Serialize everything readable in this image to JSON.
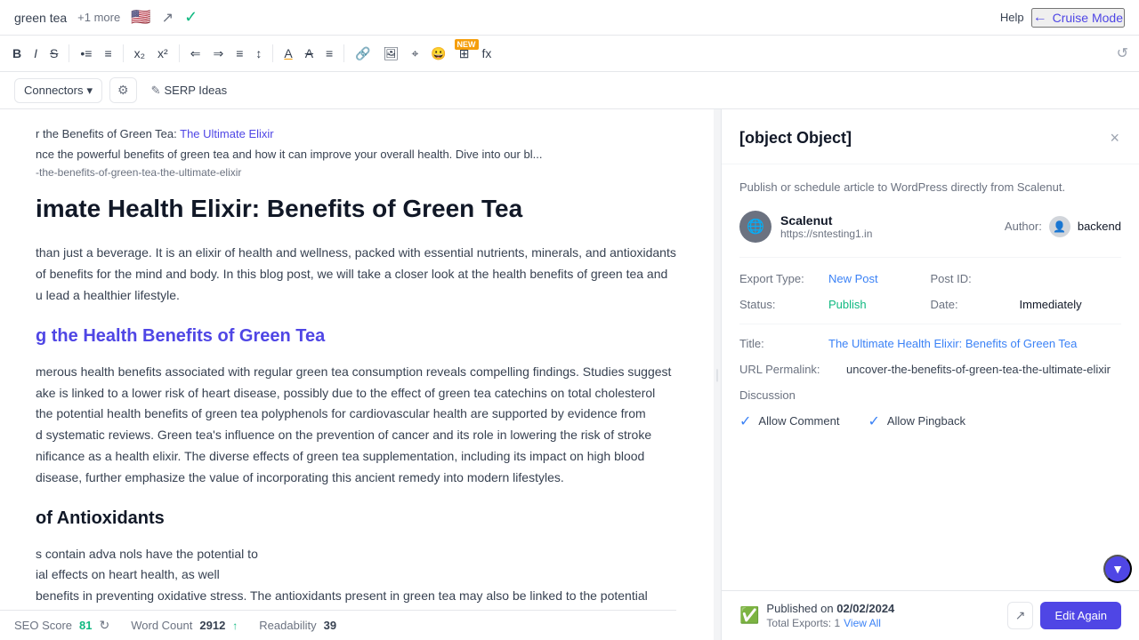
{
  "topBar": {
    "docTitle": "green tea",
    "moreCount": "+1 more",
    "helpLabel": "Help",
    "cruiseModeLabel": "Cruise Mode",
    "checkLabel": "Done"
  },
  "toolbar": {
    "buttons": [
      "B",
      "I",
      "S",
      "•≡",
      "≡",
      "x₂",
      "x²",
      "←≡",
      "→≡",
      "≡←",
      "↕",
      "A",
      "A̶",
      "≡",
      "🔗",
      "🖼",
      "⊞",
      "😊",
      "⊡",
      "fx"
    ],
    "historyIcon": "↺"
  },
  "secondaryToolbar": {
    "connectorsLabel": "Connectors",
    "settingsIcon": "⚙",
    "serpIdeasLabel": "SERP Ideas"
  },
  "article": {
    "metaLabel": "r the Benefits of Green Tea:",
    "metaLink": "The Ultimate Elixir",
    "descText": "nce the powerful benefits of green tea and how it can improve your overall health. Dive into our bl...",
    "urlSlug": "-the-benefits-of-green-tea-the-ultimate-elixir",
    "heading": "imate Health Elixir: Benefits of Green Tea",
    "body1": "than just a beverage. It is an elixir of health and wellness, packed with essential nutrients, minerals, and antioxidants",
    "body2": "of benefits for the mind and body. In this blog post, we will take a closer look at the health benefits of green tea and",
    "body3": "u lead a healthier lifestyle.",
    "section1Heading": "g the Health Benefits of Green Tea",
    "bodySection2a": "merous health benefits associated with regular green tea consumption reveals compelling findings. Studies suggest",
    "bodySection2b": "ake is linked to a lower risk of heart disease, possibly due to the effect of green tea catechins on total cholesterol",
    "bodySection2c": "the potential health benefits of green tea polyphenols for cardiovascular health are supported by evidence from",
    "bodySection2d": "d systematic reviews. Green tea's influence on the prevention of cancer and its role in lowering the risk of stroke",
    "bodySection2e": "nificance as a health elixir. The diverse effects of green tea supplementation, including its impact on high blood",
    "bodySection2f": "disease, further emphasize the value of incorporating this ancient remedy into modern lifestyles.",
    "section2Heading": "of Antioxidants",
    "bodySection3a": "s contain adva",
    "bodySection3b": "nols have the potential to",
    "bodySection3c": "ial effects on heart health, as well",
    "bodySection3d": "benefits in preventing oxidative stress. The antioxidants present in green tea may also be linked to the potential"
  },
  "sidebar": {
    "title": {
      "label": "Title:",
      "value": "The Ultimate Health Elixir: Benefits of Green Tea"
    },
    "closeLabel": "×",
    "subtitle": "Publish or schedule article to WordPress directly from Scalenut.",
    "site": {
      "name": "Scalenut",
      "url": "https://sntesting1.in",
      "logoIcon": "🌐"
    },
    "author": {
      "label": "Author:",
      "name": "backend",
      "avatarIcon": "👤"
    },
    "exportType": {
      "label": "Export Type:",
      "value": "New Post"
    },
    "postId": {
      "label": "Post ID:",
      "value": ""
    },
    "status": {
      "label": "Status:",
      "value": "Publish"
    },
    "date": {
      "label": "Date:",
      "value": "Immediately"
    },
    "urlPermalink": {
      "label": "URL Permalink:",
      "value": "uncover-the-benefits-of-green-tea-the-ultimate-elixir"
    },
    "discussion": {
      "label": "Discussion",
      "allowComment": "Allow Comment",
      "allowPingback": "Allow Pingback"
    },
    "footer": {
      "publishedLabel": "Published on",
      "publishedDate": "02/02/2024",
      "totalExportsLabel": "Total Exports: 1",
      "viewAllLabel": "View All",
      "editAgainLabel": "Edit Again",
      "externalLinkIcon": "↗"
    }
  },
  "statusBar": {
    "seoScoreLabel": "SEO Score",
    "seoScoreValue": "81",
    "wordCountLabel": "Word Count",
    "wordCountValue": "2912",
    "readabilityLabel": "Readability",
    "readabilityValue": "39"
  }
}
